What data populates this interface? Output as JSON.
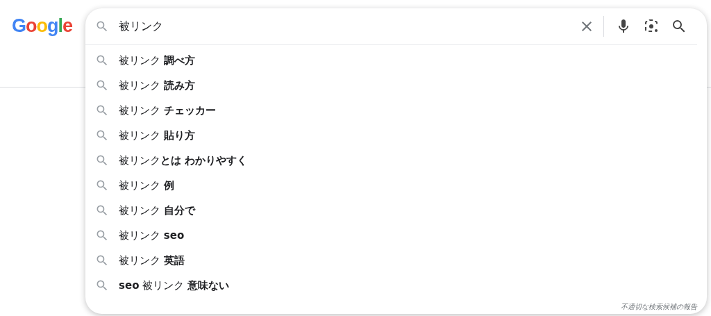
{
  "logo": {
    "letters": [
      {
        "text": "G",
        "color": "#4285f4"
      },
      {
        "text": "o",
        "color": "#ea4335"
      },
      {
        "text": "o",
        "color": "#fbbc05"
      },
      {
        "text": "g",
        "color": "#4285f4"
      },
      {
        "text": "l",
        "color": "#34a853"
      },
      {
        "text": "e",
        "color": "#ea4335"
      }
    ]
  },
  "search": {
    "value": "被リンク"
  },
  "suggestions": [
    {
      "text": "被リンク **調べ方**"
    },
    {
      "text": "被リンク **読み方**"
    },
    {
      "text": "被リンク **チェッカー**"
    },
    {
      "text": "被リンク **貼り方**"
    },
    {
      "text": "被リンク**とは わかりやすく**"
    },
    {
      "text": "被リンク **例**"
    },
    {
      "text": "被リンク **自分で**"
    },
    {
      "text": "被リンク **seo**"
    },
    {
      "text": "被リンク **英語**"
    },
    {
      "text": "**seo** 被リンク **意味ない**"
    }
  ],
  "report_link": "不適切な検索候補の報告"
}
